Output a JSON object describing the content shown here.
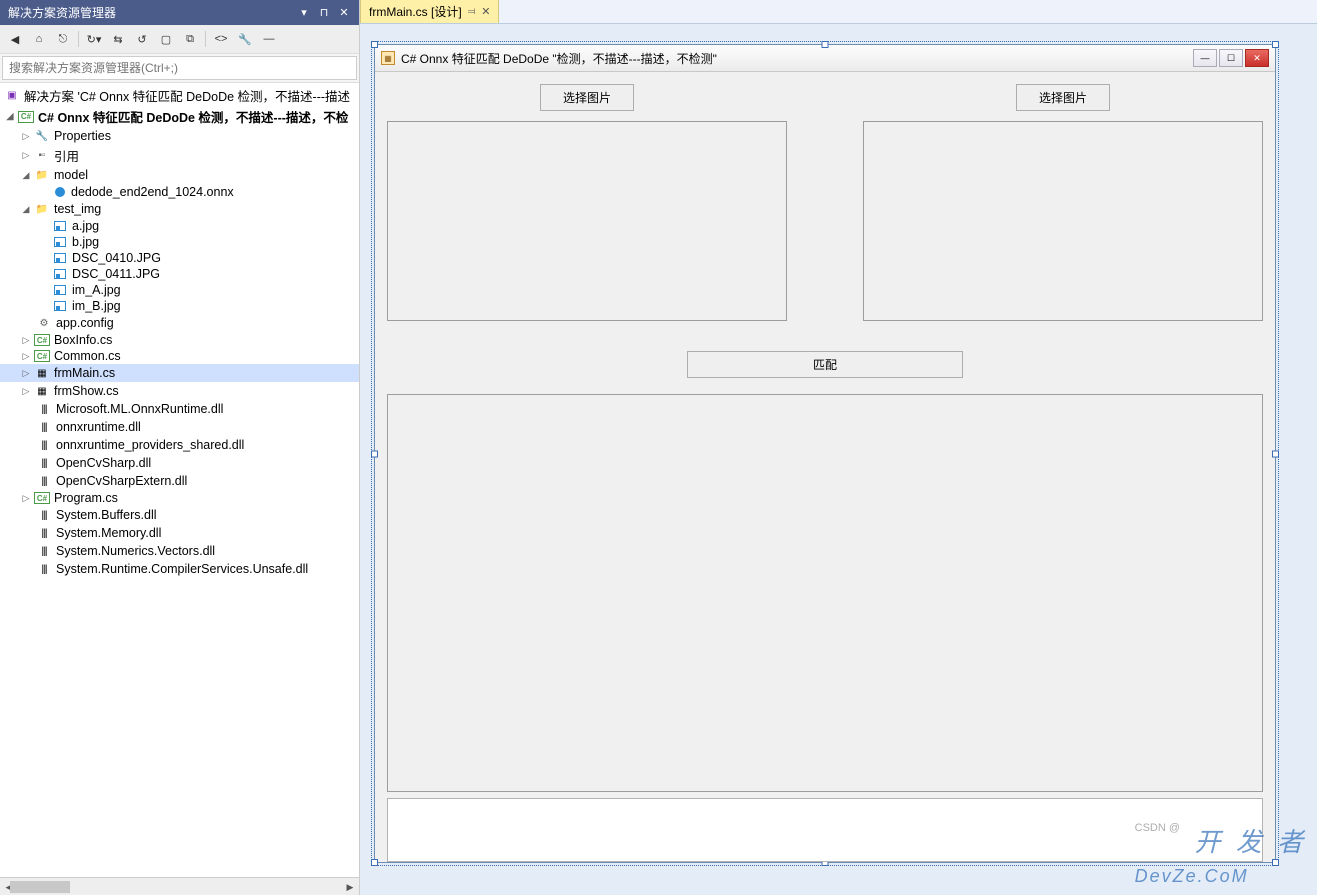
{
  "sidebar": {
    "title": "解决方案资源管理器",
    "search_placeholder": "搜索解决方案资源管理器(Ctrl+;)",
    "solution_label": "解决方案 'C# Onnx 特征匹配 DeDoDe 检测，不描述---描述",
    "project_label": "C# Onnx 特征匹配 DeDoDe 检测，不描述---描述，不检",
    "nodes": {
      "properties": "Properties",
      "references": "引用",
      "model_folder": "model",
      "model_file": "dedode_end2end_1024.onnx",
      "test_img_folder": "test_img",
      "img_a": "a.jpg",
      "img_b": "b.jpg",
      "img_dsc0": "DSC_0410.JPG",
      "img_dsc1": "DSC_0411.JPG",
      "img_imA": "im_A.jpg",
      "img_imB": "im_B.jpg",
      "appconfig": "app.config",
      "boxinfo": "BoxInfo.cs",
      "common": "Common.cs",
      "frmmain": "frmMain.cs",
      "frmshow": "frmShow.cs",
      "dll_onnxrt_ml": "Microsoft.ML.OnnxRuntime.dll",
      "dll_onnxrt": "onnxruntime.dll",
      "dll_onnxrt_ps": "onnxruntime_providers_shared.dll",
      "dll_ocvsharp": "OpenCvSharp.dll",
      "dll_ocvsharp_ext": "OpenCvSharpExtern.dll",
      "program": "Program.cs",
      "dll_sysbuf": "System.Buffers.dll",
      "dll_sysmem": "System.Memory.dll",
      "dll_sysnum": "System.Numerics.Vectors.dll",
      "dll_sysrcs": "System.Runtime.CompilerServices.Unsafe.dll"
    }
  },
  "tab": {
    "label": "frmMain.cs [设计]"
  },
  "form": {
    "title": "C# Onnx 特征匹配 DeDoDe \"检测，不描述---描述，不检测\"",
    "btn_select_left": "选择图片",
    "btn_select_right": "选择图片",
    "btn_match": "匹配"
  },
  "watermark": {
    "csdn": "CSDN @",
    "brand": "开 发 者",
    "sub": "DevZe.CoM"
  }
}
